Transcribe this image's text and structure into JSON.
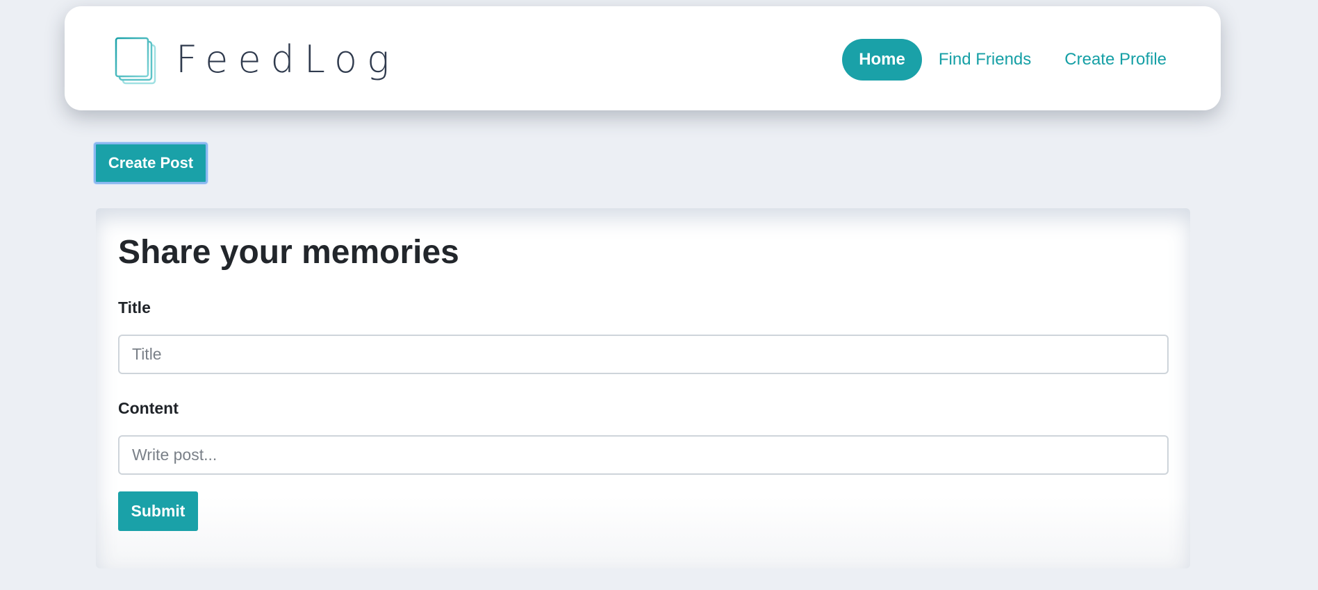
{
  "brand": {
    "name": "FeedLog",
    "icon": "stacked-pages-icon",
    "accent_color": "#1aa1a8"
  },
  "nav": {
    "items": [
      {
        "label": "Home",
        "active": true
      },
      {
        "label": "Find Friends",
        "active": false
      },
      {
        "label": "Create Profile",
        "active": false
      }
    ]
  },
  "actions": {
    "create_post_label": "Create Post"
  },
  "form": {
    "heading": "Share your memories",
    "title_label": "Title",
    "title_value": "",
    "title_placeholder": "Title",
    "content_label": "Content",
    "content_value": "",
    "content_placeholder": "Write post...",
    "submit_label": "Submit"
  }
}
